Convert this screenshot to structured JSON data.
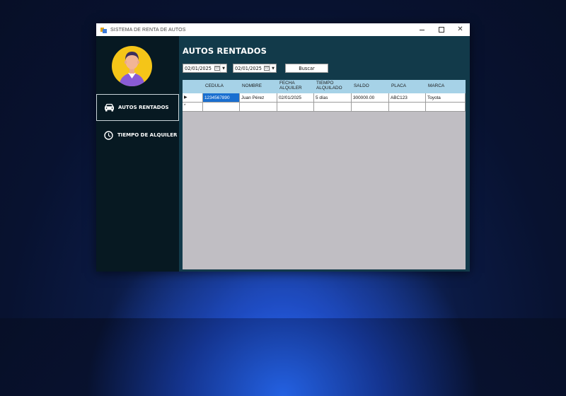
{
  "window": {
    "title": "SISTEMA DE RENTA DE AUTOS"
  },
  "sidebar": {
    "items": [
      {
        "label": "AUTOS RENTADOS",
        "icon": "car-icon",
        "active": true
      },
      {
        "label": "TIEMPO DE ALQUILER",
        "icon": "clock-icon",
        "active": false
      }
    ]
  },
  "main": {
    "title": "AUTOS RENTADOS",
    "date_from": "02/01/2025",
    "date_to": "02/01/2025",
    "search_label": "Buscar"
  },
  "grid": {
    "columns": [
      "CEDULA",
      "NOMBRE",
      "FECHA ALQUILER",
      "TIEMPO ALQUILADO",
      "SALDO",
      "PLACA",
      "MARCA"
    ],
    "rows": [
      {
        "marker": "▶",
        "cells": [
          "1234567890",
          "Juan Pérez",
          "02/01/2025",
          "5 días",
          "300000.00",
          "ABC123",
          "Toyota"
        ]
      },
      {
        "marker": "*",
        "cells": [
          "",
          "",
          "",
          "",
          "",
          "",
          ""
        ]
      }
    ],
    "colors": {
      "header": "#a6d2e7",
      "selection": "#1a6fd0",
      "empty_area": "#c0bec3"
    }
  },
  "colors": {
    "sidebar": "#071922",
    "main": "#123a4a",
    "avatar_bg": "#f5c518"
  }
}
